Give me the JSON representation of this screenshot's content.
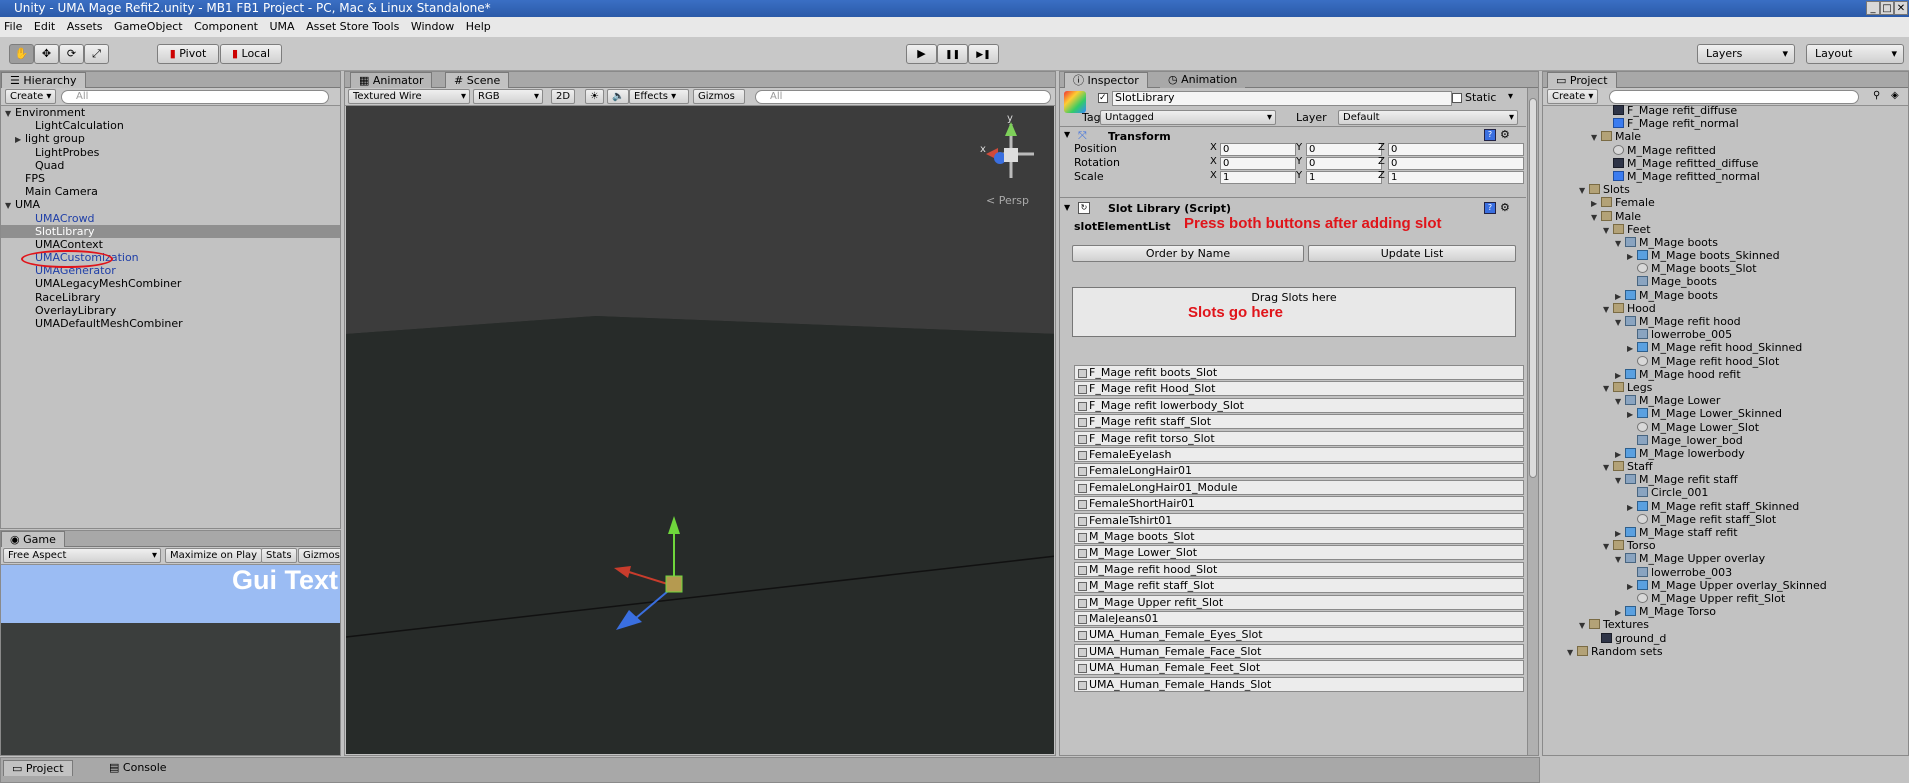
{
  "window": {
    "title": "Unity - UMA Mage Refit2.unity - MB1 FB1 Project - PC, Mac & Linux Standalone*",
    "controls": [
      "_",
      "□",
      "✕"
    ]
  },
  "menu": [
    "File",
    "Edit",
    "Assets",
    "GameObject",
    "Component",
    "UMA",
    "Asset Store Tools",
    "Window",
    "Help"
  ],
  "toolbar": {
    "tools": [
      "hand-icon",
      "move-icon",
      "rotate-icon",
      "scale-icon"
    ],
    "pivot": "Pivot",
    "local": "Local",
    "play": "▶",
    "pause": "❚❚",
    "step": "▶❚",
    "layers": "Layers",
    "layout": "Layout"
  },
  "hierarchy": {
    "tab": "Hierarchy",
    "create": "Create",
    "search": "All",
    "items": [
      {
        "label": "Environment",
        "indent": 0,
        "arrow": "▼",
        "blue": false,
        "sel": false
      },
      {
        "label": "LightCalculation",
        "indent": 2,
        "arrow": "",
        "blue": false,
        "sel": false
      },
      {
        "label": "light group",
        "indent": 1,
        "arrow": "▶",
        "blue": false,
        "sel": false
      },
      {
        "label": "LightProbes",
        "indent": 2,
        "arrow": "",
        "blue": false,
        "sel": false
      },
      {
        "label": "Quad",
        "indent": 2,
        "arrow": "",
        "blue": false,
        "sel": false
      },
      {
        "label": "FPS",
        "indent": 1,
        "arrow": "",
        "blue": false,
        "sel": false
      },
      {
        "label": "Main Camera",
        "indent": 1,
        "arrow": "",
        "blue": false,
        "sel": false
      },
      {
        "label": "UMA",
        "indent": 0,
        "arrow": "▼",
        "blue": false,
        "sel": false
      },
      {
        "label": "UMACrowd",
        "indent": 2,
        "arrow": "",
        "blue": true,
        "sel": false
      },
      {
        "label": "SlotLibrary",
        "indent": 2,
        "arrow": "",
        "blue": false,
        "sel": true
      },
      {
        "label": "UMAContext",
        "indent": 2,
        "arrow": "",
        "blue": false,
        "sel": false
      },
      {
        "label": "UMACustomization",
        "indent": 2,
        "arrow": "",
        "blue": true,
        "sel": false
      },
      {
        "label": "UMAGenerator",
        "indent": 2,
        "arrow": "",
        "blue": true,
        "sel": false
      },
      {
        "label": "UMALegacyMeshCombiner",
        "indent": 2,
        "arrow": "",
        "blue": false,
        "sel": false
      },
      {
        "label": "RaceLibrary",
        "indent": 2,
        "arrow": "",
        "blue": false,
        "sel": false
      },
      {
        "label": "OverlayLibrary",
        "indent": 2,
        "arrow": "",
        "blue": false,
        "sel": false
      },
      {
        "label": "UMADefaultMeshCombiner",
        "indent": 2,
        "arrow": "",
        "blue": false,
        "sel": false
      }
    ]
  },
  "game": {
    "tab": "Game",
    "aspect": "Free Aspect",
    "maximize": "Maximize on Play",
    "stats": "Stats",
    "gizmos": "Gizmos",
    "gui_text": "Gui Text"
  },
  "scene": {
    "tabs": [
      "Animator",
      "Scene"
    ],
    "mode": "Textured Wire",
    "rgb": "RGB",
    "twod": "2D",
    "effects": "Effects",
    "gizmos": "Gizmos",
    "search": "All",
    "persp": "< Persp",
    "axis_y": "y",
    "axis_x": "x"
  },
  "inspector": {
    "tabs": [
      "Inspector",
      "Animation"
    ],
    "object_name": "SlotLibrary",
    "static": "Static",
    "tag_label": "Tag",
    "tag": "Untagged",
    "layer_label": "Layer",
    "layer": "Default",
    "transform": {
      "title": "Transform",
      "rows": [
        {
          "label": "Position",
          "x": "0",
          "y": "0",
          "z": "0"
        },
        {
          "label": "Rotation",
          "x": "0",
          "y": "0",
          "z": "0"
        },
        {
          "label": "Scale",
          "x": "1",
          "y": "1",
          "z": "1"
        }
      ]
    },
    "script": {
      "title": "Slot Library (Script)",
      "field": "slotElementList",
      "note": "Press both buttons after adding slot",
      "order_btn": "Order by Name",
      "update_btn": "Update List",
      "drag": "Drag Slots here",
      "drag_note": "Slots go here"
    },
    "slots": [
      "F_Mage refit boots_Slot",
      "F_Mage refit Hood_Slot",
      "F_Mage refit lowerbody_Slot",
      "F_Mage refit staff_Slot",
      "F_Mage refit torso_Slot",
      "FemaleEyelash",
      "FemaleLongHair01",
      "FemaleLongHair01_Module",
      "FemaleShortHair01",
      "FemaleTshirt01",
      "M_Mage boots_Slot",
      "M_Mage Lower_Slot",
      "M_Mage refit hood_Slot",
      "M_Mage refit staff_Slot",
      "M_Mage Upper refit_Slot",
      "MaleJeans01",
      "UMA_Human_Female_Eyes_Slot",
      "UMA_Human_Female_Face_Slot",
      "UMA_Human_Female_Feet_Slot",
      "UMA_Human_Female_Hands_Slot"
    ]
  },
  "project": {
    "tab": "Project",
    "create": "Create",
    "items": [
      {
        "label": "F_Mage refit_diffuse",
        "indent": 4,
        "arrow": "",
        "icon": "tex"
      },
      {
        "label": "F_Mage refit_normal",
        "indent": 4,
        "arrow": "",
        "icon": "norm"
      },
      {
        "label": "Male",
        "indent": 3,
        "arrow": "▼",
        "icon": "folder"
      },
      {
        "label": "M_Mage refitted",
        "indent": 4,
        "arrow": "",
        "icon": "mat"
      },
      {
        "label": "M_Mage refitted_diffuse",
        "indent": 4,
        "arrow": "",
        "icon": "tex"
      },
      {
        "label": "M_Mage refitted_normal",
        "indent": 4,
        "arrow": "",
        "icon": "norm"
      },
      {
        "label": "Slots",
        "indent": 2,
        "arrow": "▼",
        "icon": "folder"
      },
      {
        "label": "Female",
        "indent": 3,
        "arrow": "▶",
        "icon": "folder"
      },
      {
        "label": "Male",
        "indent": 3,
        "arrow": "▼",
        "icon": "folder"
      },
      {
        "label": "Feet",
        "indent": 4,
        "arrow": "▼",
        "icon": "folder"
      },
      {
        "label": "M_Mage boots",
        "indent": 5,
        "arrow": "▼",
        "icon": "mesh"
      },
      {
        "label": "M_Mage boots_Skinned",
        "indent": 6,
        "arrow": "▶",
        "icon": "cube"
      },
      {
        "label": "M_Mage boots_Slot",
        "indent": 6,
        "arrow": "",
        "icon": "mat"
      },
      {
        "label": "Mage_boots",
        "indent": 6,
        "arrow": "",
        "icon": "mesh"
      },
      {
        "label": "M_Mage boots",
        "indent": 5,
        "arrow": "▶",
        "icon": "cube"
      },
      {
        "label": "Hood",
        "indent": 4,
        "arrow": "▼",
        "icon": "folder"
      },
      {
        "label": "M_Mage refit hood",
        "indent": 5,
        "arrow": "▼",
        "icon": "mesh"
      },
      {
        "label": "lowerrobe_005",
        "indent": 6,
        "arrow": "",
        "icon": "mesh"
      },
      {
        "label": "M_Mage refit hood_Skinned",
        "indent": 6,
        "arrow": "▶",
        "icon": "cube"
      },
      {
        "label": "M_Mage refit hood_Slot",
        "indent": 6,
        "arrow": "",
        "icon": "mat"
      },
      {
        "label": "M_Mage hood refit",
        "indent": 5,
        "arrow": "▶",
        "icon": "cube"
      },
      {
        "label": "Legs",
        "indent": 4,
        "arrow": "▼",
        "icon": "folder"
      },
      {
        "label": "M_Mage Lower",
        "indent": 5,
        "arrow": "▼",
        "icon": "mesh"
      },
      {
        "label": "M_Mage Lower_Skinned",
        "indent": 6,
        "arrow": "▶",
        "icon": "cube"
      },
      {
        "label": "M_Mage Lower_Slot",
        "indent": 6,
        "arrow": "",
        "icon": "mat"
      },
      {
        "label": "Mage_lower_bod",
        "indent": 6,
        "arrow": "",
        "icon": "mesh"
      },
      {
        "label": "M_Mage lowerbody",
        "indent": 5,
        "arrow": "▶",
        "icon": "cube"
      },
      {
        "label": "Staff",
        "indent": 4,
        "arrow": "▼",
        "icon": "folder"
      },
      {
        "label": "M_Mage refit staff",
        "indent": 5,
        "arrow": "▼",
        "icon": "mesh"
      },
      {
        "label": "Circle_001",
        "indent": 6,
        "arrow": "",
        "icon": "mesh"
      },
      {
        "label": "M_Mage refit staff_Skinned",
        "indent": 6,
        "arrow": "▶",
        "icon": "cube"
      },
      {
        "label": "M_Mage refit staff_Slot",
        "indent": 6,
        "arrow": "",
        "icon": "mat"
      },
      {
        "label": "M_Mage staff refit",
        "indent": 5,
        "arrow": "▶",
        "icon": "cube"
      },
      {
        "label": "Torso",
        "indent": 4,
        "arrow": "▼",
        "icon": "folder"
      },
      {
        "label": "M_Mage Upper overlay",
        "indent": 5,
        "arrow": "▼",
        "icon": "mesh"
      },
      {
        "label": "lowerrobe_003",
        "indent": 6,
        "arrow": "",
        "icon": "mesh"
      },
      {
        "label": "M_Mage Upper overlay_Skinned",
        "indent": 6,
        "arrow": "▶",
        "icon": "cube"
      },
      {
        "label": "M_Mage Upper refit_Slot",
        "indent": 6,
        "arrow": "",
        "icon": "mat"
      },
      {
        "label": "M_Mage Torso",
        "indent": 5,
        "arrow": "▶",
        "icon": "cube"
      },
      {
        "label": "Textures",
        "indent": 2,
        "arrow": "▼",
        "icon": "folder"
      },
      {
        "label": "ground_d",
        "indent": 3,
        "arrow": "",
        "icon": "tex"
      },
      {
        "label": "Random sets",
        "indent": 1,
        "arrow": "▼",
        "icon": "folder"
      }
    ]
  },
  "bottom": {
    "project_tab": "Project",
    "console_tab": "Console"
  }
}
